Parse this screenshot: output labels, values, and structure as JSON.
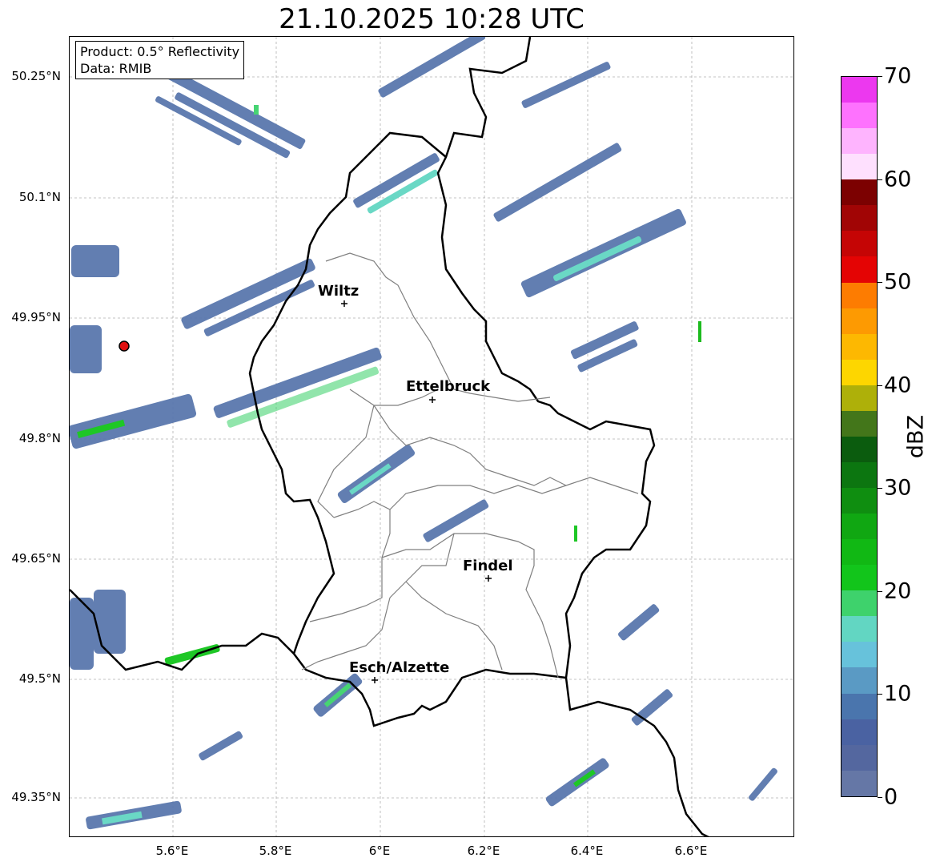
{
  "title": "21.10.2025 10:28 UTC",
  "info": {
    "product": "Product: 0.5° Reflectivity",
    "data": "Data: RMIB"
  },
  "lat_labels": [
    "50.25°N",
    "50.1°N",
    "49.95°N",
    "49.8°N",
    "49.65°N",
    "49.5°N",
    "49.35°N"
  ],
  "lon_labels": [
    "5.6°E",
    "5.8°E",
    "6°E",
    "6.2°E",
    "6.4°E",
    "6.6°E"
  ],
  "cities": [
    {
      "name": "Wiltz"
    },
    {
      "name": "Ettelbruck"
    },
    {
      "name": "Findel"
    },
    {
      "name": "Esch/Alzette"
    }
  ],
  "colorbar": {
    "label": "dBZ",
    "ticks": [
      "70",
      "60",
      "50",
      "40",
      "30",
      "20",
      "10",
      "0"
    ],
    "colors": [
      "#6577a6",
      "#54679f",
      "#4a62a2",
      "#4a75ad",
      "#5a9ac4",
      "#67c2db",
      "#62d6c2",
      "#3ed26c",
      "#12c51b",
      "#11b814",
      "#10a712",
      "#0f8e10",
      "#0c7610",
      "#0b5c0e",
      "#43761a",
      "#aeb009",
      "#fdd600",
      "#fdb801",
      "#fd9a02",
      "#fd7c01",
      "#e40404",
      "#c50505",
      "#a10505",
      "#7c0101",
      "#fee0fe",
      "#feb4fe",
      "#fe72fe",
      "#ec38ef"
    ]
  },
  "radar_site_color": "#e01010"
}
